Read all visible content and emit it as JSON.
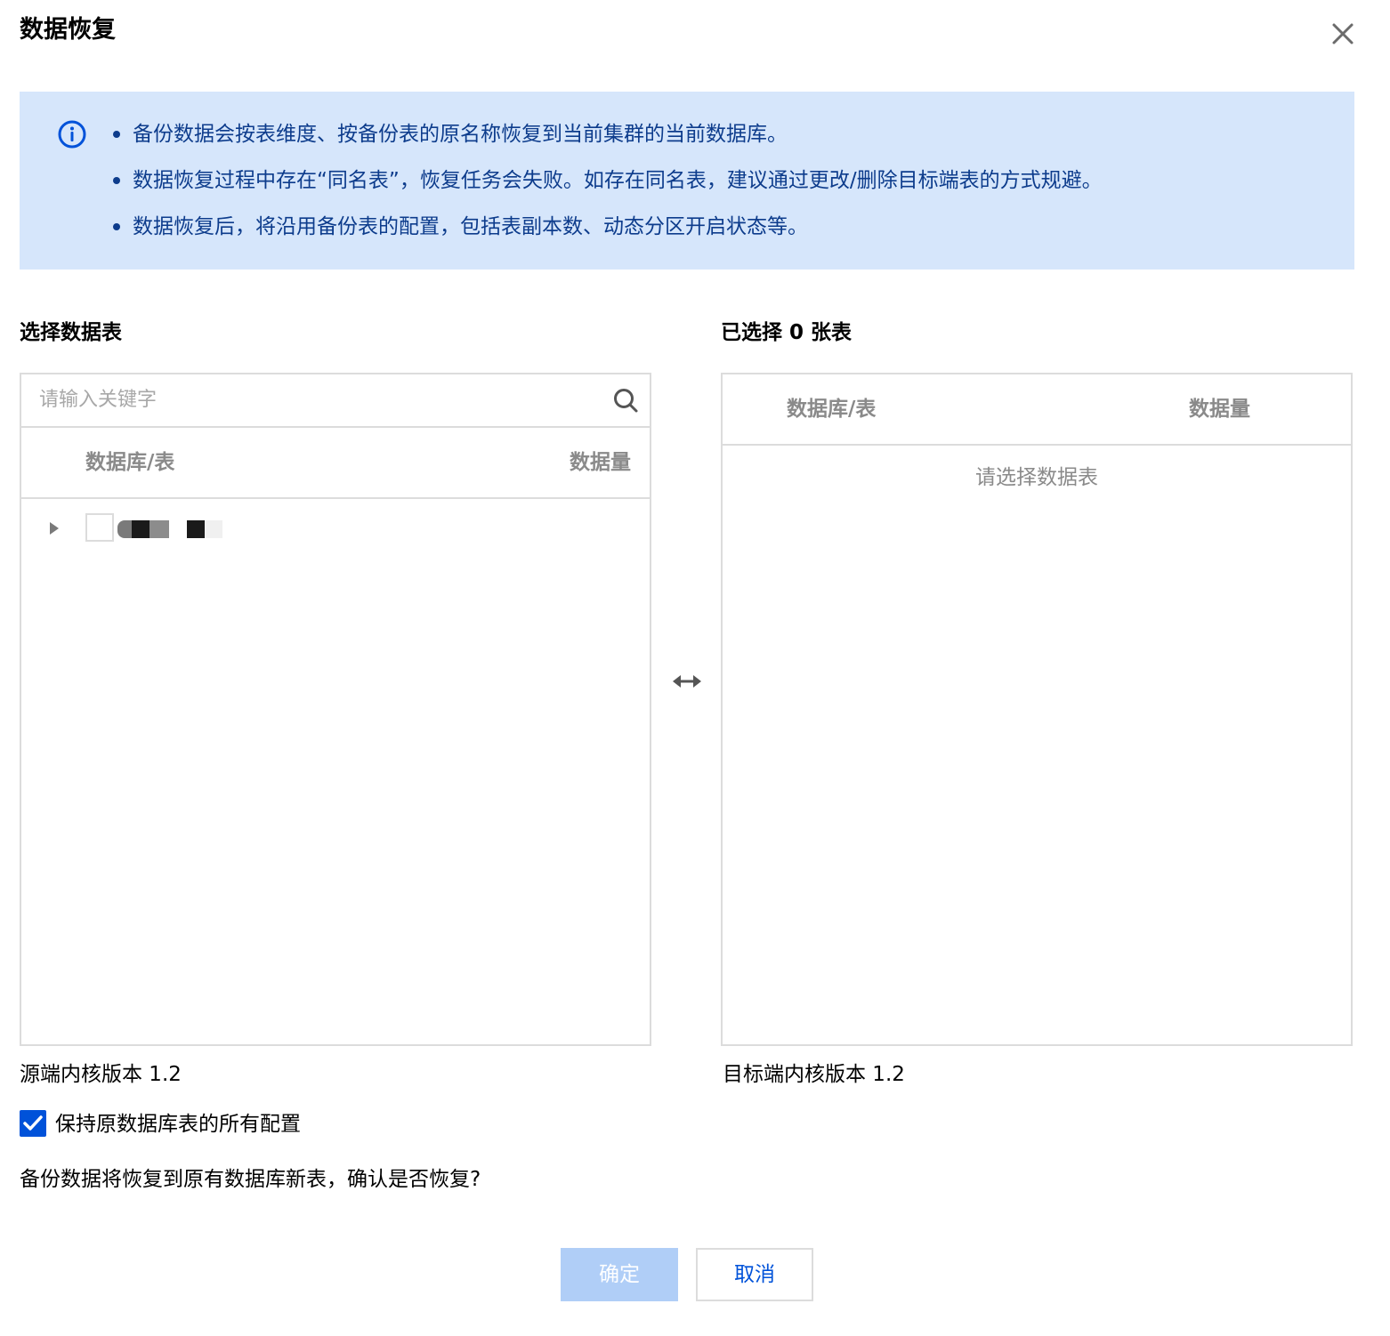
{
  "dialog": {
    "title": "数据恢复"
  },
  "info": {
    "items": [
      "备份数据会按表维度、按备份表的原名称恢复到当前集群的当前数据库。",
      "数据恢复过程中存在“同名表”，恢复任务会失败。如存在同名表，建议通过更改/删除目标端表的方式规避。",
      "数据恢复后，将沿用备份表的配置，包括表副本数、动态分区开启状态等。"
    ]
  },
  "left_panel": {
    "heading": "选择数据表",
    "search_placeholder": "请输入关键字",
    "columns": {
      "name": "数据库/表",
      "size": "数据量"
    },
    "rows": [
      {
        "expanded": false,
        "checked": false,
        "name_redacted": true
      }
    ],
    "version_label": "源端内核版本  1.2"
  },
  "right_panel": {
    "heading": "已选择 0 张表",
    "columns": {
      "name": "数据库/表",
      "size": "数据量"
    },
    "empty_text": "请选择数据表",
    "version_label": "目标端内核版本  1.2"
  },
  "options": {
    "keep_config_label": "保持原数据库表的所有配置",
    "keep_config_checked": true
  },
  "confirm_message": "备份数据将恢复到原有数据库新表，确认是否恢复?",
  "buttons": {
    "ok": "确定",
    "cancel": "取消"
  },
  "icons": {
    "close": "close-icon",
    "info": "info-icon",
    "search": "search-icon",
    "transfer": "transfer-arrows-icon",
    "expand": "caret-right-icon",
    "check": "check-icon"
  },
  "colors": {
    "primary": "#0052d9",
    "banner_bg": "#d6e6fb",
    "banner_text": "#0d3c8c",
    "disabled_primary": "#b0cef7",
    "border": "#dcdcdc",
    "muted_text": "#8a8a8a"
  }
}
